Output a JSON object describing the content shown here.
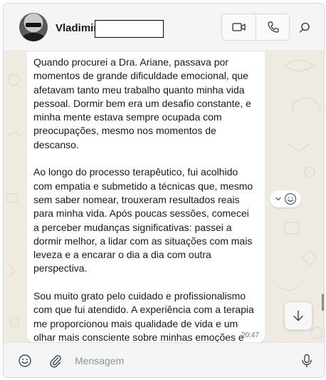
{
  "header": {
    "contact_name": "Vladimir",
    "video_call_icon": "video-camera-icon",
    "voice_call_icon": "phone-icon",
    "search_icon": "search-icon"
  },
  "message": {
    "text": "Quando procurei a Dra. Ariane, passava por momentos de grande dificuldade emocional, que afetavam tanto meu trabalho quanto minha vida pessoal. Dormir bem era um desafio constante, e minha mente estava sempre ocupada com preocupações, mesmo nos momentos de descanso.\n\nAo longo do processo terapêutico, fui acolhido com empatia e submetido a técnicas que, mesmo sem saber nomear, trouxeram resultados reais para minha vida. Após poucas sessões, comecei a perceber mudanças significativas: passei a dormir melhor, a lidar com as situações com mais leveza e a encarar o dia a dia com outra perspectiva.\n\nSou muito grato pelo cuidado e profissionalismo com que fui atendido. A experiência com a terapia me proporcionou mais qualidade de vida e um olhar mais consciente sobre minhas emoções e atitudes.”",
    "time": "20:47"
  },
  "composer": {
    "placeholder": "Mensagem",
    "emoji_icon": "smiley-icon",
    "attach_icon": "paperclip-icon",
    "mic_icon": "microphone-icon"
  },
  "colors": {
    "chat_background": "#efeae2",
    "bubble": "#ffffff",
    "header": "#f5f5f5",
    "timestamp": "#667781"
  }
}
